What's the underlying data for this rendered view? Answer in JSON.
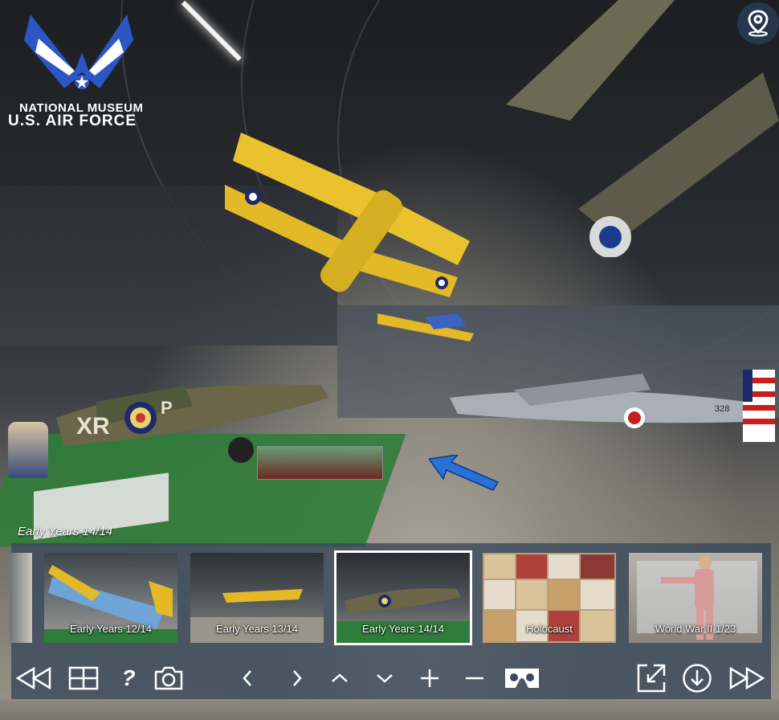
{
  "logo": {
    "line1": "NATIONAL MUSEUM",
    "line2": "U.S. AIR FORCE",
    "icon": "usaf-wings-logo"
  },
  "map_button": {
    "icon": "map-pin-icon"
  },
  "scene": {
    "title": "Early Years 14/14"
  },
  "aircraft_markings": {
    "hurricane_code": "XR",
    "hurricane_code2": "P",
    "tail_number": "328"
  },
  "thumbnails": [
    {
      "label": "Early Years 12/14",
      "active": false
    },
    {
      "label": "Early Years 13/14",
      "active": false
    },
    {
      "label": "Early Years 14/14",
      "active": true
    },
    {
      "label": "Holocaust",
      "active": false
    },
    {
      "label": "World War II 1/23",
      "active": false
    }
  ],
  "toolbar": {
    "rewind": "rewind-icon",
    "grid": "grid-icon",
    "help": "?",
    "camera": "camera-icon",
    "left": "chevron-left-icon",
    "right": "chevron-right-icon",
    "up": "chevron-up-icon",
    "down": "chevron-down-icon",
    "zoom_in": "plus-icon",
    "zoom_out": "minus-icon",
    "vr": "vr-headset-icon",
    "fullscreen": "fullscreen-icon",
    "download": "download-icon",
    "fast_forward": "fast-forward-icon"
  },
  "colors": {
    "panel": "#374658",
    "arrow": "#2a6fd6",
    "logo_blue": "#2c56c6",
    "active_border": "#ffffff"
  }
}
